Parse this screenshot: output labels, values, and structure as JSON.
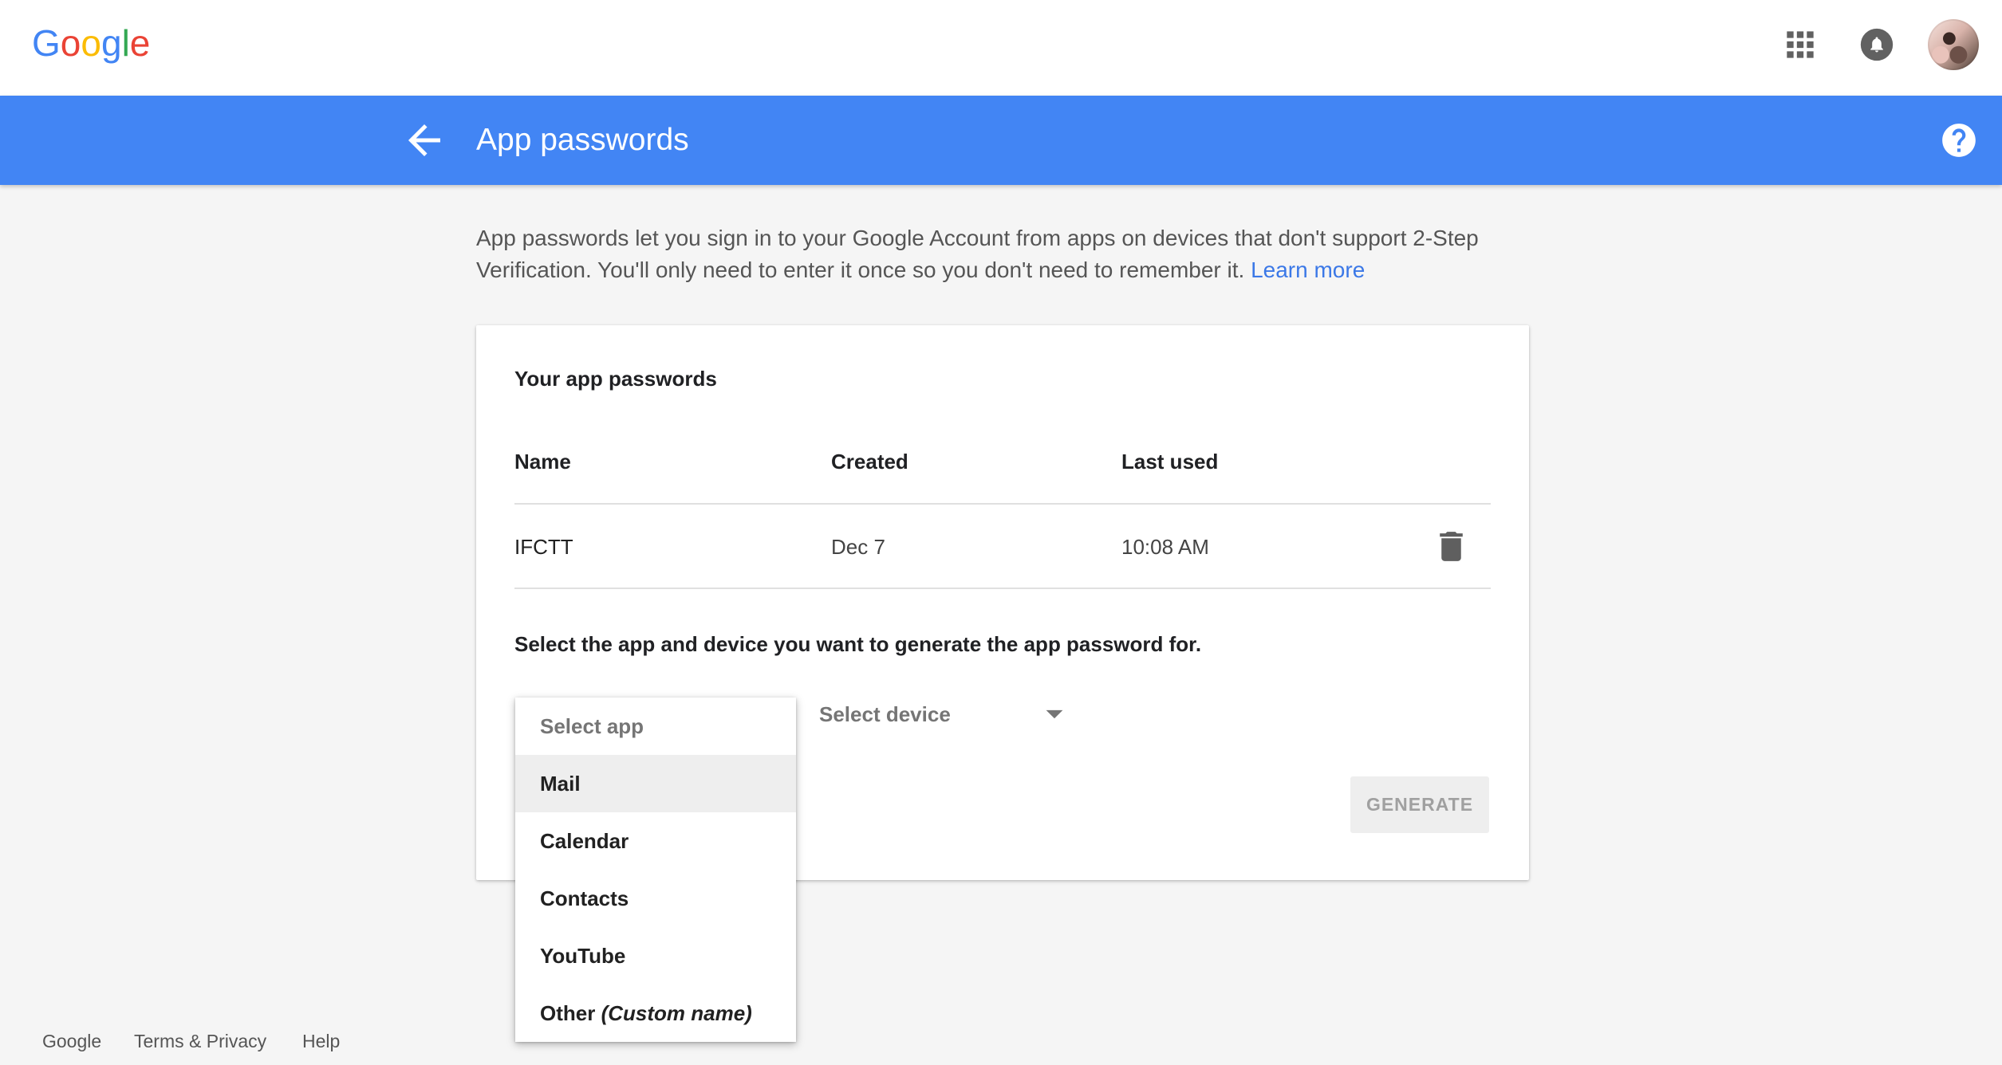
{
  "colors": {
    "title_bar": "#4285f4",
    "link": "#3b78e7",
    "page_background": "#f5f5f5"
  },
  "header": {
    "logo": "Google",
    "logo_colors": [
      "#4285F4",
      "#EA4335",
      "#FBBC05",
      "#4285F4",
      "#34A853",
      "#EA4335"
    ],
    "icons": {
      "apps": "apps-grid-icon",
      "notifications": "notifications-bell-icon",
      "account": "account-avatar"
    }
  },
  "title_bar": {
    "back_icon": "back-arrow-icon",
    "title": "App passwords",
    "help_icon": "help-icon"
  },
  "intro": {
    "text": "App passwords let you sign in to your Google Account from apps on devices that don't support 2-Step Verification. You'll only need to enter it once so you don't need to remember it.",
    "learn_more": "Learn more"
  },
  "passwords_card": {
    "heading": "Your app passwords",
    "columns": [
      "Name",
      "Created",
      "Last used"
    ],
    "rows": [
      {
        "name": "IFCTT",
        "created": "Dec 7",
        "last_used": "10:08 AM",
        "delete_icon": "trash-icon"
      }
    ],
    "generate_prompt": "Select the app and device you want to generate the app password for.",
    "app_select": {
      "open": true,
      "placeholder": "Select app",
      "options": [
        "Mail",
        "Calendar",
        "Contacts",
        "YouTube",
        "Other"
      ],
      "other_hint": "(Custom name)",
      "highlighted": "Mail"
    },
    "device_select": {
      "placeholder": "Select device",
      "icon": "dropdown-arrow-icon"
    },
    "generate_button": {
      "label": "GENERATE",
      "enabled": false
    }
  },
  "footer": {
    "links": [
      "Google",
      "Terms & Privacy",
      "Help"
    ]
  }
}
